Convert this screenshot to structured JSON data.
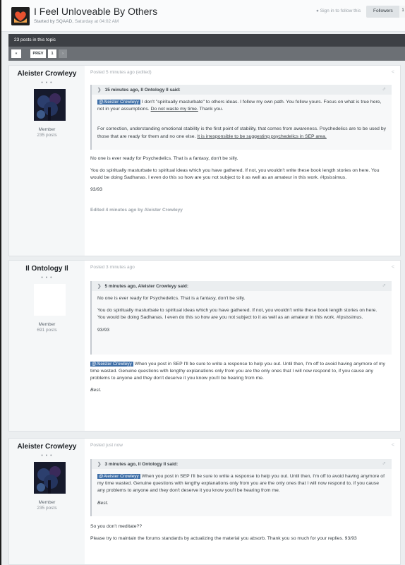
{
  "header": {
    "title": "I Feel Unloveable By Others",
    "started_by": "Started by SQAAD,",
    "started_time": "Saturday at 04:02 AM",
    "signin_label": "Sign in to follow this",
    "followers_label": "Followers",
    "followers_count": "1"
  },
  "topic_bar": {
    "count_text": "23 posts in this topic"
  },
  "pagination": {
    "first": "«",
    "prev": "PREV",
    "page": "1",
    "next": "›"
  },
  "posts": [
    {
      "author": "Aleister Crowleyy",
      "dots": "• • •",
      "role": "Member",
      "post_count": "235 posts",
      "posted": "Posted 5 minutes ago (edited)",
      "quote": {
        "header": "15 minutes ago, Il Ontology Il said:",
        "mention": "@Aleister Crowleyy",
        "p1_text": " I don't \"spiritually masturbate\" to others ideas. I follow my own path. You follow yours. Focus on what is true here, not in your assumptions. ",
        "p1_link": "Do not waste my time.",
        "p1_end": " Thank you.",
        "p2_text": "For correction, understanding emotional stability is the first point of stability, that comes from awareness. Psychedelics are to be used by those that are ready for them and no one else. ",
        "p2_link": "It is irresponsible to be suggesting psychedelics in SEP area."
      },
      "p1": "No one is ever ready for Psychedelics. That is a fantasy, don't be silly.",
      "p2": "You do spiritually masturbate to spiritual ideas which you have gathered. If not, you wouldn't write these book length stories on here. You would be doing Sadhanas. I even do this so how are you not subject to it as well as an amateur in this work. #Ipsissimus.",
      "p3": "93/93",
      "edited": "Edited 4 minutes ago by Aleister Crowleyy"
    },
    {
      "author": "Il Ontology Il",
      "dots": "• • •",
      "role": "Member",
      "post_count": "691 posts",
      "posted": "Posted 3 minutes ago",
      "quote": {
        "header": "5 minutes ago, Aleister Crowleyy said:",
        "p1": "No one is ever ready for Psychedelics. That is a fantasy, don't be silly.",
        "p2": "You do spiritually masturbate to spiritual ideas which you have gathered. If not, you wouldn't write these book length stories on here. You would be doing Sadhanas. I even do this so how are you not subject to it as well as an amateur in this work. #Ipsissimus.",
        "p3": "93/93"
      },
      "mention": "@Aleister Crowleyy",
      "p1": " When you post in SEP I'll be sure to write a response to help you out. Until then, I'm off to avoid having anymore of my time wasted. Genuine questions with lengthy explanations only from you are the only ones that I will now respond to, if you cause any problems to anyone and they don't deserve it you know you'll be hearing from me.",
      "p2": "Best."
    },
    {
      "author": "Aleister Crowleyy",
      "dots": "• • •",
      "role": "Member",
      "post_count": "235 posts",
      "posted": "Posted just now",
      "quote": {
        "header": "3 minutes ago, Il Ontology Il said:",
        "mention": "@Aleister Crowleyy",
        "p1": " When you post in SEP I'll be sure to write a response to help you out. Until then, I'm off to avoid having anymore of my time wasted. Genuine questions with lengthy explanations only from you are the only ones that I will now respond to, if you cause any problems to anyone and they don't deserve it you know you'll be hearing from me.",
        "p2": "Best."
      },
      "p1": "So you don't meditate??",
      "p2": "Please try to maintain the forums standards by actualizing the material you absorb. Thank you so much for your replies. 93/93"
    }
  ],
  "icons": {
    "topic": "heart-hands-icon",
    "quote": "quote-icon",
    "share": "share-icon",
    "signin": "follow-icon"
  },
  "colors": {
    "mention_bg": "#3d6ea7",
    "count_bar": "#3d4045",
    "pager_bar": "#6c7075"
  }
}
